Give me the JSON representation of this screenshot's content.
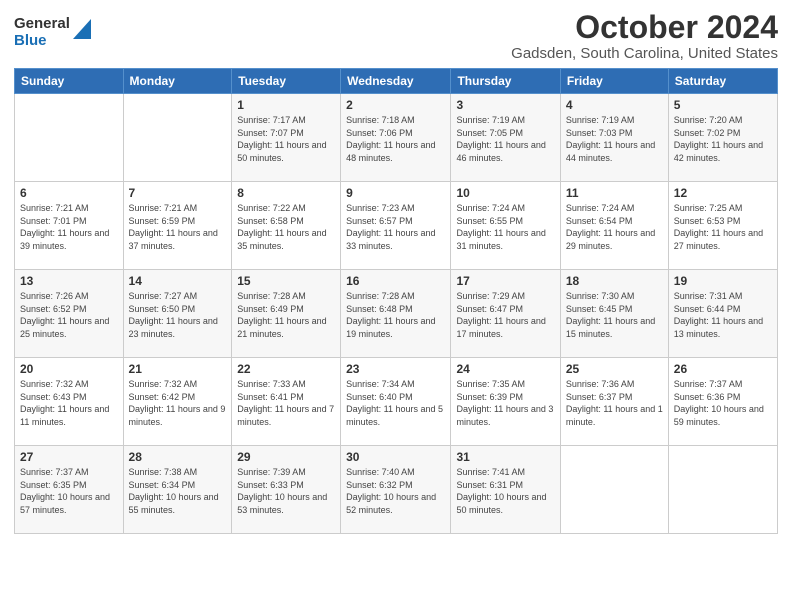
{
  "logo": {
    "general": "General",
    "blue": "Blue"
  },
  "header": {
    "month": "October 2024",
    "location": "Gadsden, South Carolina, United States"
  },
  "weekdays": [
    "Sunday",
    "Monday",
    "Tuesday",
    "Wednesday",
    "Thursday",
    "Friday",
    "Saturday"
  ],
  "weeks": [
    [
      {
        "day": "",
        "info": ""
      },
      {
        "day": "",
        "info": ""
      },
      {
        "day": "1",
        "info": "Sunrise: 7:17 AM\nSunset: 7:07 PM\nDaylight: 11 hours and 50 minutes."
      },
      {
        "day": "2",
        "info": "Sunrise: 7:18 AM\nSunset: 7:06 PM\nDaylight: 11 hours and 48 minutes."
      },
      {
        "day": "3",
        "info": "Sunrise: 7:19 AM\nSunset: 7:05 PM\nDaylight: 11 hours and 46 minutes."
      },
      {
        "day": "4",
        "info": "Sunrise: 7:19 AM\nSunset: 7:03 PM\nDaylight: 11 hours and 44 minutes."
      },
      {
        "day": "5",
        "info": "Sunrise: 7:20 AM\nSunset: 7:02 PM\nDaylight: 11 hours and 42 minutes."
      }
    ],
    [
      {
        "day": "6",
        "info": "Sunrise: 7:21 AM\nSunset: 7:01 PM\nDaylight: 11 hours and 39 minutes."
      },
      {
        "day": "7",
        "info": "Sunrise: 7:21 AM\nSunset: 6:59 PM\nDaylight: 11 hours and 37 minutes."
      },
      {
        "day": "8",
        "info": "Sunrise: 7:22 AM\nSunset: 6:58 PM\nDaylight: 11 hours and 35 minutes."
      },
      {
        "day": "9",
        "info": "Sunrise: 7:23 AM\nSunset: 6:57 PM\nDaylight: 11 hours and 33 minutes."
      },
      {
        "day": "10",
        "info": "Sunrise: 7:24 AM\nSunset: 6:55 PM\nDaylight: 11 hours and 31 minutes."
      },
      {
        "day": "11",
        "info": "Sunrise: 7:24 AM\nSunset: 6:54 PM\nDaylight: 11 hours and 29 minutes."
      },
      {
        "day": "12",
        "info": "Sunrise: 7:25 AM\nSunset: 6:53 PM\nDaylight: 11 hours and 27 minutes."
      }
    ],
    [
      {
        "day": "13",
        "info": "Sunrise: 7:26 AM\nSunset: 6:52 PM\nDaylight: 11 hours and 25 minutes."
      },
      {
        "day": "14",
        "info": "Sunrise: 7:27 AM\nSunset: 6:50 PM\nDaylight: 11 hours and 23 minutes."
      },
      {
        "day": "15",
        "info": "Sunrise: 7:28 AM\nSunset: 6:49 PM\nDaylight: 11 hours and 21 minutes."
      },
      {
        "day": "16",
        "info": "Sunrise: 7:28 AM\nSunset: 6:48 PM\nDaylight: 11 hours and 19 minutes."
      },
      {
        "day": "17",
        "info": "Sunrise: 7:29 AM\nSunset: 6:47 PM\nDaylight: 11 hours and 17 minutes."
      },
      {
        "day": "18",
        "info": "Sunrise: 7:30 AM\nSunset: 6:45 PM\nDaylight: 11 hours and 15 minutes."
      },
      {
        "day": "19",
        "info": "Sunrise: 7:31 AM\nSunset: 6:44 PM\nDaylight: 11 hours and 13 minutes."
      }
    ],
    [
      {
        "day": "20",
        "info": "Sunrise: 7:32 AM\nSunset: 6:43 PM\nDaylight: 11 hours and 11 minutes."
      },
      {
        "day": "21",
        "info": "Sunrise: 7:32 AM\nSunset: 6:42 PM\nDaylight: 11 hours and 9 minutes."
      },
      {
        "day": "22",
        "info": "Sunrise: 7:33 AM\nSunset: 6:41 PM\nDaylight: 11 hours and 7 minutes."
      },
      {
        "day": "23",
        "info": "Sunrise: 7:34 AM\nSunset: 6:40 PM\nDaylight: 11 hours and 5 minutes."
      },
      {
        "day": "24",
        "info": "Sunrise: 7:35 AM\nSunset: 6:39 PM\nDaylight: 11 hours and 3 minutes."
      },
      {
        "day": "25",
        "info": "Sunrise: 7:36 AM\nSunset: 6:37 PM\nDaylight: 11 hours and 1 minute."
      },
      {
        "day": "26",
        "info": "Sunrise: 7:37 AM\nSunset: 6:36 PM\nDaylight: 10 hours and 59 minutes."
      }
    ],
    [
      {
        "day": "27",
        "info": "Sunrise: 7:37 AM\nSunset: 6:35 PM\nDaylight: 10 hours and 57 minutes."
      },
      {
        "day": "28",
        "info": "Sunrise: 7:38 AM\nSunset: 6:34 PM\nDaylight: 10 hours and 55 minutes."
      },
      {
        "day": "29",
        "info": "Sunrise: 7:39 AM\nSunset: 6:33 PM\nDaylight: 10 hours and 53 minutes."
      },
      {
        "day": "30",
        "info": "Sunrise: 7:40 AM\nSunset: 6:32 PM\nDaylight: 10 hours and 52 minutes."
      },
      {
        "day": "31",
        "info": "Sunrise: 7:41 AM\nSunset: 6:31 PM\nDaylight: 10 hours and 50 minutes."
      },
      {
        "day": "",
        "info": ""
      },
      {
        "day": "",
        "info": ""
      }
    ]
  ]
}
